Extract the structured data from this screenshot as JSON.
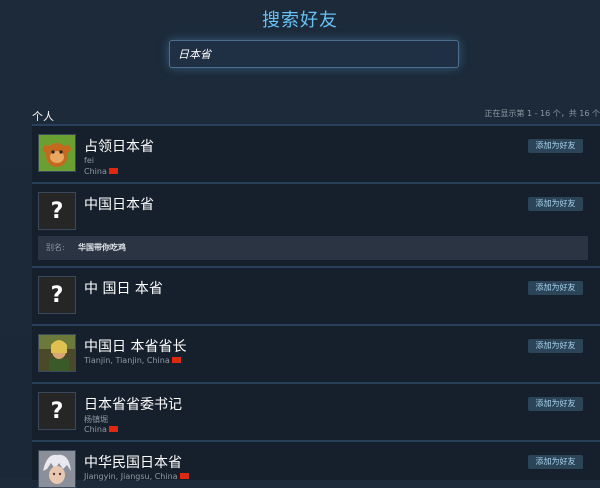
{
  "page": {
    "title": "搜索好友"
  },
  "search": {
    "value": "日本省"
  },
  "section": {
    "label": "个人",
    "count_text": "正在显示第 1 - 16 个，共 16 个"
  },
  "add_label": "添加为好友",
  "alias_label": "别名:",
  "results": [
    {
      "name": "占领日本省",
      "line1": "fei",
      "line2": "China",
      "avatar": "monkey",
      "has_flag": true
    },
    {
      "name": "中国日本省",
      "avatar": "unknown",
      "alias": "华国带你吃鸡"
    },
    {
      "name": "中 国日 本省",
      "avatar": "unknown"
    },
    {
      "name": "中国日 本省省长",
      "line1": "Tianjin, Tianjin, China",
      "avatar": "character",
      "has_flag": true
    },
    {
      "name": "日本省省委书记",
      "line1": "杨镇堀",
      "line2": "China",
      "avatar": "unknown",
      "has_flag": true
    },
    {
      "name": "中华民国日本省",
      "line1": "Jiangyin, Jiangsu, China",
      "avatar": "anime",
      "has_flag": true
    }
  ]
}
